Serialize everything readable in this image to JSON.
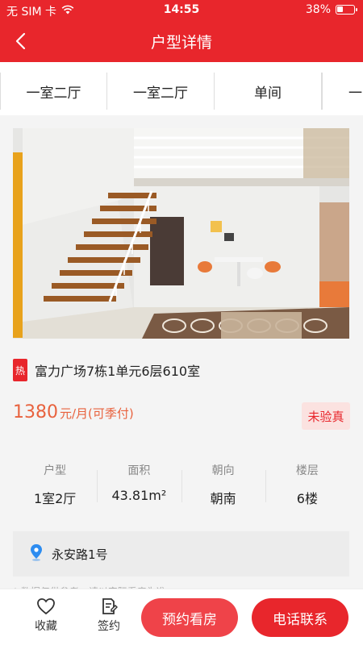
{
  "status": {
    "carrier": "无 SIM 卡",
    "time": "14:55",
    "battery": "38%",
    "battery_level": 0.38
  },
  "nav": {
    "title": "户型详情"
  },
  "tabs": [
    "一室二厅",
    "一室二厅",
    "单间",
    "一"
  ],
  "listing": {
    "hot_badge": "热",
    "title": "富力广场7栋1单元6层610室",
    "price": "1380",
    "price_unit": "元/月(可季付)",
    "verify_badge": "未验真"
  },
  "stats": [
    {
      "label": "户型",
      "value": "1室2厅"
    },
    {
      "label": "面积",
      "value": "43.81m²"
    },
    {
      "label": "朝向",
      "value": "朝南"
    },
    {
      "label": "楼层",
      "value": "6楼"
    }
  ],
  "address": "永安路1号",
  "note": "* 数据仅供参考，请以实际看房为准",
  "bottom": {
    "favorite_label": "收藏",
    "sign_label": "签约",
    "book_label": "预约看房",
    "call_label": "电话联系"
  },
  "colors": {
    "brand": "#e8262c",
    "price": "#e8623e"
  }
}
